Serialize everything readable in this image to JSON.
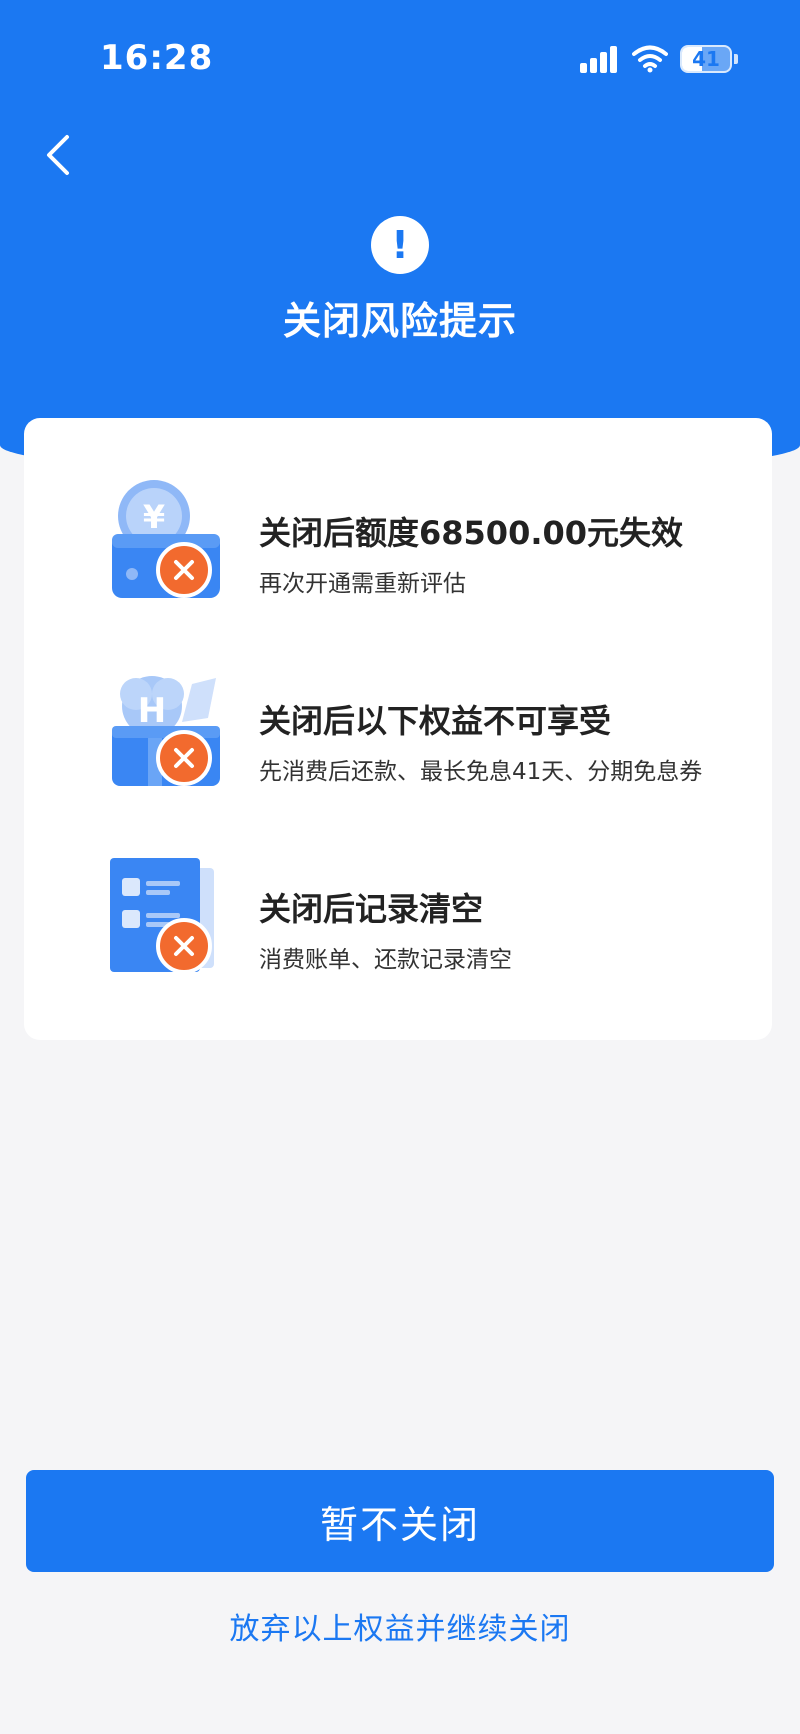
{
  "status_bar": {
    "time": "16:28",
    "battery_level": "41",
    "battery_fraction": 0.41,
    "icons": [
      "signal-icon",
      "wifi-icon",
      "battery-icon"
    ]
  },
  "header": {
    "back_icon": "chevron-left-icon",
    "warning_icon": "exclamation-circle-icon",
    "warning_glyph": "!",
    "title": "关闭风险提示"
  },
  "items": [
    {
      "icon": "wallet-yuan-icon",
      "title": "关闭后额度68500.00元失效",
      "subtitle": "再次开通需重新评估"
    },
    {
      "icon": "gift-benefits-icon",
      "title": "关闭后以下权益不可享受",
      "subtitle": "先消费后还款、最长免息41天、分期免息券"
    },
    {
      "icon": "records-document-icon",
      "title": "关闭后记录清空",
      "subtitle": "消费账单、还款记录清空"
    }
  ],
  "actions": {
    "primary_label": "暂不关闭",
    "secondary_label": "放弃以上权益并继续关闭"
  },
  "colors": {
    "primary": "#1b78f2",
    "badge": "#f26a2e",
    "background": "#f5f5f7"
  }
}
